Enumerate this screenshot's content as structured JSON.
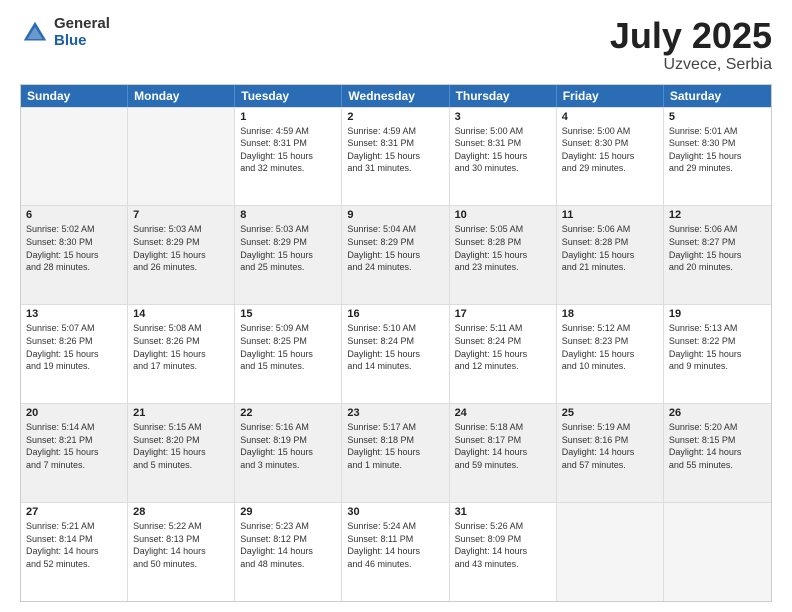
{
  "header": {
    "logo_general": "General",
    "logo_blue": "Blue",
    "title": "July 2025",
    "location": "Uzvece, Serbia"
  },
  "days_of_week": [
    "Sunday",
    "Monday",
    "Tuesday",
    "Wednesday",
    "Thursday",
    "Friday",
    "Saturday"
  ],
  "weeks": [
    [
      {
        "day": "",
        "empty": true
      },
      {
        "day": "",
        "empty": true
      },
      {
        "day": "1",
        "lines": [
          "Sunrise: 4:59 AM",
          "Sunset: 8:31 PM",
          "Daylight: 15 hours",
          "and 32 minutes."
        ]
      },
      {
        "day": "2",
        "lines": [
          "Sunrise: 4:59 AM",
          "Sunset: 8:31 PM",
          "Daylight: 15 hours",
          "and 31 minutes."
        ]
      },
      {
        "day": "3",
        "lines": [
          "Sunrise: 5:00 AM",
          "Sunset: 8:31 PM",
          "Daylight: 15 hours",
          "and 30 minutes."
        ]
      },
      {
        "day": "4",
        "lines": [
          "Sunrise: 5:00 AM",
          "Sunset: 8:30 PM",
          "Daylight: 15 hours",
          "and 29 minutes."
        ]
      },
      {
        "day": "5",
        "lines": [
          "Sunrise: 5:01 AM",
          "Sunset: 8:30 PM",
          "Daylight: 15 hours",
          "and 29 minutes."
        ]
      }
    ],
    [
      {
        "day": "6",
        "lines": [
          "Sunrise: 5:02 AM",
          "Sunset: 8:30 PM",
          "Daylight: 15 hours",
          "and 28 minutes."
        ],
        "shaded": true
      },
      {
        "day": "7",
        "lines": [
          "Sunrise: 5:03 AM",
          "Sunset: 8:29 PM",
          "Daylight: 15 hours",
          "and 26 minutes."
        ],
        "shaded": true
      },
      {
        "day": "8",
        "lines": [
          "Sunrise: 5:03 AM",
          "Sunset: 8:29 PM",
          "Daylight: 15 hours",
          "and 25 minutes."
        ],
        "shaded": true
      },
      {
        "day": "9",
        "lines": [
          "Sunrise: 5:04 AM",
          "Sunset: 8:29 PM",
          "Daylight: 15 hours",
          "and 24 minutes."
        ],
        "shaded": true
      },
      {
        "day": "10",
        "lines": [
          "Sunrise: 5:05 AM",
          "Sunset: 8:28 PM",
          "Daylight: 15 hours",
          "and 23 minutes."
        ],
        "shaded": true
      },
      {
        "day": "11",
        "lines": [
          "Sunrise: 5:06 AM",
          "Sunset: 8:28 PM",
          "Daylight: 15 hours",
          "and 21 minutes."
        ],
        "shaded": true
      },
      {
        "day": "12",
        "lines": [
          "Sunrise: 5:06 AM",
          "Sunset: 8:27 PM",
          "Daylight: 15 hours",
          "and 20 minutes."
        ],
        "shaded": true
      }
    ],
    [
      {
        "day": "13",
        "lines": [
          "Sunrise: 5:07 AM",
          "Sunset: 8:26 PM",
          "Daylight: 15 hours",
          "and 19 minutes."
        ]
      },
      {
        "day": "14",
        "lines": [
          "Sunrise: 5:08 AM",
          "Sunset: 8:26 PM",
          "Daylight: 15 hours",
          "and 17 minutes."
        ]
      },
      {
        "day": "15",
        "lines": [
          "Sunrise: 5:09 AM",
          "Sunset: 8:25 PM",
          "Daylight: 15 hours",
          "and 15 minutes."
        ]
      },
      {
        "day": "16",
        "lines": [
          "Sunrise: 5:10 AM",
          "Sunset: 8:24 PM",
          "Daylight: 15 hours",
          "and 14 minutes."
        ]
      },
      {
        "day": "17",
        "lines": [
          "Sunrise: 5:11 AM",
          "Sunset: 8:24 PM",
          "Daylight: 15 hours",
          "and 12 minutes."
        ]
      },
      {
        "day": "18",
        "lines": [
          "Sunrise: 5:12 AM",
          "Sunset: 8:23 PM",
          "Daylight: 15 hours",
          "and 10 minutes."
        ]
      },
      {
        "day": "19",
        "lines": [
          "Sunrise: 5:13 AM",
          "Sunset: 8:22 PM",
          "Daylight: 15 hours",
          "and 9 minutes."
        ]
      }
    ],
    [
      {
        "day": "20",
        "lines": [
          "Sunrise: 5:14 AM",
          "Sunset: 8:21 PM",
          "Daylight: 15 hours",
          "and 7 minutes."
        ],
        "shaded": true
      },
      {
        "day": "21",
        "lines": [
          "Sunrise: 5:15 AM",
          "Sunset: 8:20 PM",
          "Daylight: 15 hours",
          "and 5 minutes."
        ],
        "shaded": true
      },
      {
        "day": "22",
        "lines": [
          "Sunrise: 5:16 AM",
          "Sunset: 8:19 PM",
          "Daylight: 15 hours",
          "and 3 minutes."
        ],
        "shaded": true
      },
      {
        "day": "23",
        "lines": [
          "Sunrise: 5:17 AM",
          "Sunset: 8:18 PM",
          "Daylight: 15 hours",
          "and 1 minute."
        ],
        "shaded": true
      },
      {
        "day": "24",
        "lines": [
          "Sunrise: 5:18 AM",
          "Sunset: 8:17 PM",
          "Daylight: 14 hours",
          "and 59 minutes."
        ],
        "shaded": true
      },
      {
        "day": "25",
        "lines": [
          "Sunrise: 5:19 AM",
          "Sunset: 8:16 PM",
          "Daylight: 14 hours",
          "and 57 minutes."
        ],
        "shaded": true
      },
      {
        "day": "26",
        "lines": [
          "Sunrise: 5:20 AM",
          "Sunset: 8:15 PM",
          "Daylight: 14 hours",
          "and 55 minutes."
        ],
        "shaded": true
      }
    ],
    [
      {
        "day": "27",
        "lines": [
          "Sunrise: 5:21 AM",
          "Sunset: 8:14 PM",
          "Daylight: 14 hours",
          "and 52 minutes."
        ]
      },
      {
        "day": "28",
        "lines": [
          "Sunrise: 5:22 AM",
          "Sunset: 8:13 PM",
          "Daylight: 14 hours",
          "and 50 minutes."
        ]
      },
      {
        "day": "29",
        "lines": [
          "Sunrise: 5:23 AM",
          "Sunset: 8:12 PM",
          "Daylight: 14 hours",
          "and 48 minutes."
        ]
      },
      {
        "day": "30",
        "lines": [
          "Sunrise: 5:24 AM",
          "Sunset: 8:11 PM",
          "Daylight: 14 hours",
          "and 46 minutes."
        ]
      },
      {
        "day": "31",
        "lines": [
          "Sunrise: 5:26 AM",
          "Sunset: 8:09 PM",
          "Daylight: 14 hours",
          "and 43 minutes."
        ]
      },
      {
        "day": "",
        "empty": true
      },
      {
        "day": "",
        "empty": true
      }
    ]
  ]
}
